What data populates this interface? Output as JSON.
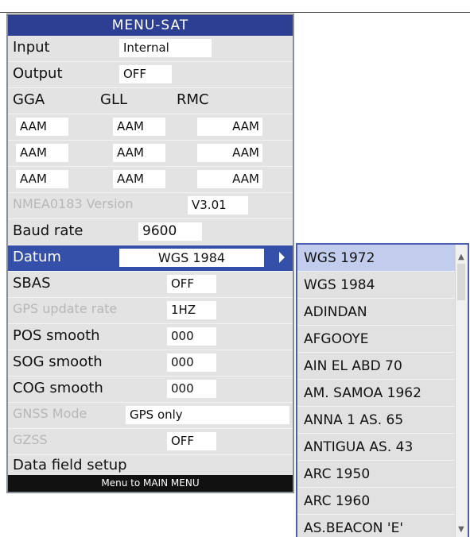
{
  "menu": {
    "title": "MENU-SAT",
    "input": {
      "label": "Input",
      "value": "Internal"
    },
    "output": {
      "label": "Output",
      "value": "OFF"
    },
    "sentences": {
      "gga": "GGA",
      "gll": "GLL",
      "rmc": "RMC"
    },
    "aam_rows": [
      [
        "AAM",
        "AAM",
        "AAM"
      ],
      [
        "AAM",
        "AAM",
        "AAM"
      ],
      [
        "AAM",
        "AAM",
        "AAM"
      ]
    ],
    "nmea_version": {
      "label": "NMEA0183 Version",
      "value": "V3.01"
    },
    "baud_rate": {
      "label": "Baud rate",
      "value": "9600"
    },
    "datum": {
      "label": "Datum",
      "value": "WGS 1984"
    },
    "sbas": {
      "label": "SBAS",
      "value": "OFF"
    },
    "gps_update_rate": {
      "label": "GPS update rate",
      "value": "1HZ"
    },
    "pos_smooth": {
      "label": "POS smooth",
      "value": "000"
    },
    "sog_smooth": {
      "label": "SOG smooth",
      "value": "000"
    },
    "cog_smooth": {
      "label": "COG smooth",
      "value": "000"
    },
    "gnss_mode": {
      "label": "GNSS Mode",
      "value": "GPS only"
    },
    "gzss": {
      "label": "GZSS",
      "value": "OFF"
    },
    "data_field_setup": {
      "label": "Data field setup"
    },
    "footer": "Menu to MAIN MENU"
  },
  "datum_list": {
    "items": [
      "WGS 1972",
      "WGS 1984",
      "ADINDAN",
      "AFGOOYE",
      "AIN EL ABD 70",
      "AM. SAMOA 1962",
      "ANNA 1 AS. 65",
      "ANTIGUA AS. 43",
      "ARC 1950",
      "ARC 1960",
      "AS.BEACON 'E'"
    ],
    "selected": "WGS 1972"
  },
  "icons": {
    "submenu_arrow": "chevron-right-icon",
    "scroll_up": "arrow-up-icon",
    "scroll_down": "arrow-down-icon"
  },
  "colors": {
    "title_bar": "#2c3f93",
    "highlight_row": "#3450a8",
    "selected_item": "#c2ccec",
    "panel_bg": "#e3e3e3",
    "disabled_text": "#b7b7b7",
    "footer_bg": "#111111"
  }
}
